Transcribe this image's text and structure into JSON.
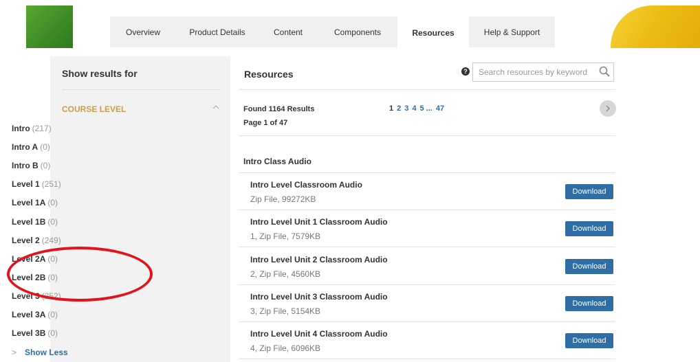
{
  "tabs": [
    {
      "label": "Overview",
      "active": false
    },
    {
      "label": "Product Details",
      "active": false
    },
    {
      "label": "Content",
      "active": false
    },
    {
      "label": "Components",
      "active": false
    },
    {
      "label": "Resources",
      "active": true
    },
    {
      "label": "Help & Support",
      "active": false
    }
  ],
  "sidebar": {
    "title": "Show results for",
    "section_label": "COURSE LEVEL",
    "items": [
      {
        "name": "Intro",
        "count": "(217)"
      },
      {
        "name": "Intro A",
        "count": "(0)"
      },
      {
        "name": "Intro B",
        "count": "(0)"
      },
      {
        "name": "Level 1",
        "count": "(251)"
      },
      {
        "name": "Level 1A",
        "count": "(0)"
      },
      {
        "name": "Level 1B",
        "count": "(0)"
      },
      {
        "name": "Level 2",
        "count": "(249)"
      },
      {
        "name": "Level 2A",
        "count": "(0)"
      },
      {
        "name": "Level 2B",
        "count": "(0)"
      },
      {
        "name": "Level 3",
        "count": "(252)"
      },
      {
        "name": "Level 3A",
        "count": "(0)"
      },
      {
        "name": "Level 3B",
        "count": "(0)"
      }
    ],
    "show_less": "Show Less"
  },
  "resources": {
    "title": "Resources",
    "search_placeholder": "Search resources by keyword",
    "found": "Found 1164 Results",
    "page_of": "Page 1 of 47",
    "pagination": {
      "current": "1",
      "pages": [
        "2",
        "3",
        "4",
        "5 ..."
      ],
      "last": "47"
    },
    "group_title": "Intro Class Audio",
    "items": [
      {
        "title": "Intro Level Classroom Audio",
        "meta": "Zip File, 99272KB",
        "button": "Download"
      },
      {
        "title": "Intro Level Unit 1 Classroom Audio",
        "meta": "1, Zip File, 7579KB",
        "button": "Download"
      },
      {
        "title": "Intro Level Unit 2 Classroom Audio",
        "meta": "2, Zip File, 4560KB",
        "button": "Download"
      },
      {
        "title": "Intro Level Unit 3 Classroom Audio",
        "meta": "3, Zip File, 5154KB",
        "button": "Download"
      },
      {
        "title": "Intro Level Unit 4 Classroom Audio",
        "meta": "4, Zip File, 6096KB",
        "button": "Download"
      }
    ]
  },
  "colors": {
    "accent_blue": "#2f6ea5",
    "section_gold": "#c9a04a",
    "annotation_red": "#e2141a"
  },
  "icons": [
    "help-icon",
    "search-icon",
    "chevron-up-icon",
    "chevron-right-icon"
  ]
}
